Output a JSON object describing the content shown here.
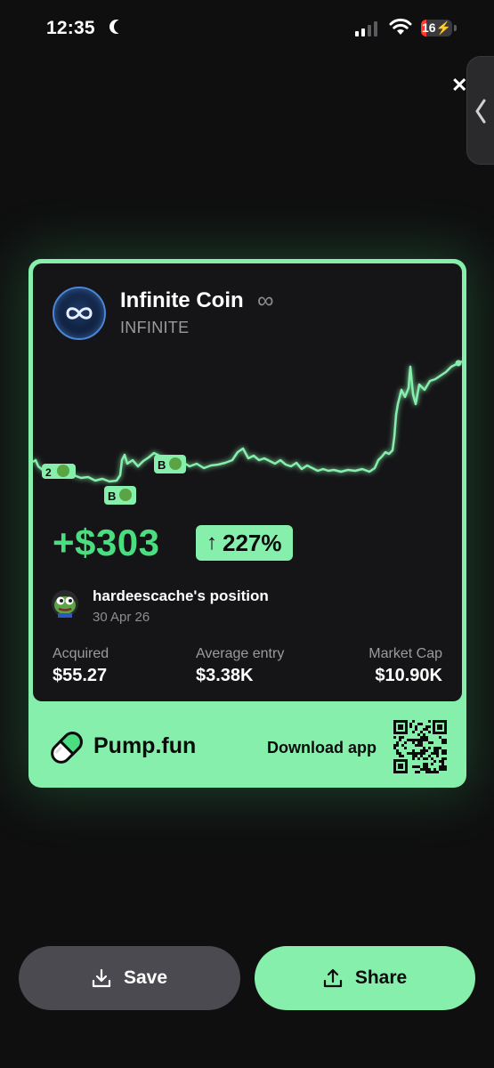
{
  "status_bar": {
    "time": "12:35",
    "battery": "16",
    "battery_level": 0.16,
    "signal_bars_active": 2,
    "signal_bars_total": 4
  },
  "card": {
    "coin_name": "Infinite Coin",
    "coin_name_icon": "∞",
    "ticker": "INFINITE",
    "pnl_value": "+$303",
    "pnl_badge_arrow": "↑",
    "pnl_badge_percent": "227%",
    "holder_name": "hardeescache's position",
    "holder_date": "30 Apr 26",
    "stats": [
      {
        "label": "Acquired",
        "value": "$55.27"
      },
      {
        "label": "Average entry",
        "value": "$3.38K"
      },
      {
        "label": "Market Cap",
        "value": "$10.90K"
      }
    ],
    "brand_name": "Pump.fun",
    "download_label": "Download app",
    "chart_markers": [
      {
        "label": "2"
      },
      {
        "label": "B"
      },
      {
        "label": "B"
      }
    ]
  },
  "buttons": {
    "save": "Save",
    "share": "Share"
  },
  "colors": {
    "accent": "#4ade80",
    "accent_light": "#86efac",
    "card_bg": "#151517",
    "page_bg": "#0f0f10"
  },
  "icons": [
    "moon-icon",
    "signal-icon",
    "wifi-icon",
    "battery-icon",
    "close-icon",
    "chevron-left-icon",
    "infinity-icon",
    "pepe-avatar-icon",
    "pill-icon",
    "qr-code-icon",
    "download-icon",
    "share-icon"
  ]
}
